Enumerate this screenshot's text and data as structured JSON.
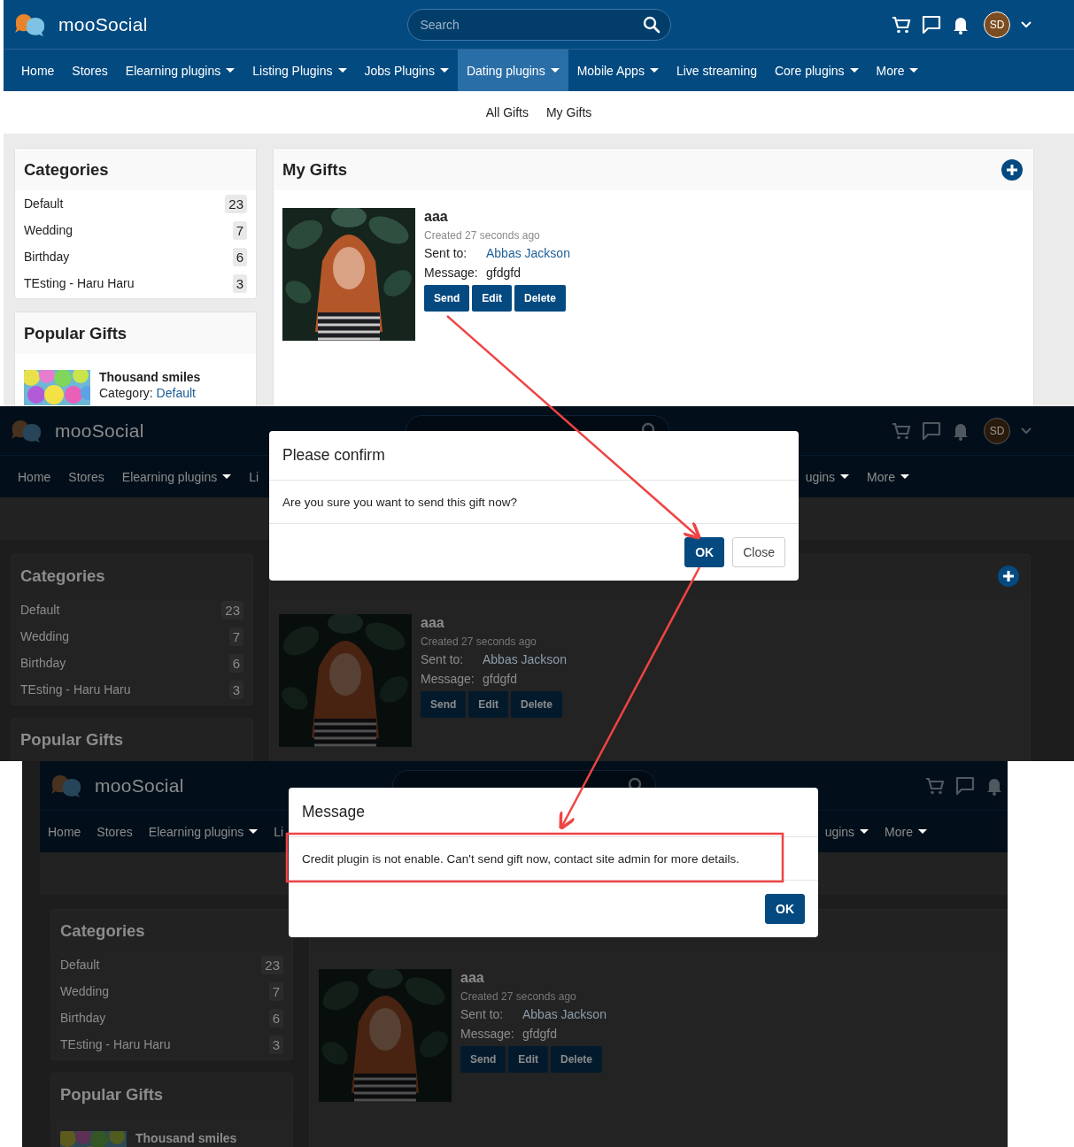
{
  "screens": [
    {
      "dimmed": false,
      "header": {
        "logo": "mooSocial",
        "search_placeholder": "Search",
        "avatar": "SD"
      },
      "nav_left": [
        {
          "label": "Home",
          "dropdown": false,
          "selected": false
        },
        {
          "label": "Stores",
          "dropdown": false,
          "selected": false
        },
        {
          "label": "Elearning plugins",
          "dropdown": true,
          "selected": false
        },
        {
          "label": "Listing Plugins",
          "dropdown": true,
          "selected": false
        },
        {
          "label": "Jobs Plugins",
          "dropdown": true,
          "selected": false
        },
        {
          "label": "Dating plugins",
          "dropdown": true,
          "selected": true
        },
        {
          "label": "Mobile Apps",
          "dropdown": true,
          "selected": false
        },
        {
          "label": "Live streaming",
          "dropdown": false,
          "selected": false
        },
        {
          "label": "Core plugins",
          "dropdown": true,
          "selected": false
        },
        {
          "label": "More",
          "dropdown": true,
          "selected": false
        }
      ],
      "subnav": [
        "All Gifts",
        "My Gifts"
      ],
      "categories": {
        "title": "Categories",
        "items": [
          {
            "name": "Default",
            "count": "23"
          },
          {
            "name": "Wedding",
            "count": "7"
          },
          {
            "name": "Birthday",
            "count": "6"
          },
          {
            "name": "TEsting - Haru Haru",
            "count": "3"
          }
        ]
      },
      "popular": {
        "title": "Popular Gifts",
        "items": [
          {
            "name": "Thousand smiles",
            "category_label": "Category:",
            "category": "Default"
          }
        ]
      },
      "gifts": {
        "title": "My Gifts",
        "show_add": true,
        "items": [
          {
            "name": "aaa",
            "created": "Created 27 seconds ago",
            "sent_label": "Sent to:",
            "recipient": "Abbas Jackson",
            "message_label": "Message:",
            "message": "gfdgfd",
            "actions": [
              "Send",
              "Edit",
              "Delete"
            ]
          }
        ]
      }
    },
    {
      "dimmed": true,
      "header": {
        "logo": "mooSocial",
        "avatar": "SD"
      },
      "nav_left": [
        {
          "label": "Home",
          "dropdown": false,
          "selected": false
        },
        {
          "label": "Stores",
          "dropdown": false,
          "selected": false
        },
        {
          "label": "Elearning plugins",
          "dropdown": true,
          "selected": false
        },
        {
          "label": "Li",
          "dropdown": false,
          "selected": false
        }
      ],
      "nav_right": [
        {
          "label": "ugins",
          "dropdown": true,
          "selected": false
        },
        {
          "label": "More",
          "dropdown": true,
          "selected": false
        }
      ],
      "categories": {
        "title": "Categories",
        "items": [
          {
            "name": "Default",
            "count": "23"
          },
          {
            "name": "Wedding",
            "count": "7"
          },
          {
            "name": "Birthday",
            "count": "6"
          },
          {
            "name": "TEsting - Haru Haru",
            "count": "3"
          }
        ]
      },
      "popular": {
        "title": "Popular Gifts"
      },
      "gifts": {
        "show_add": true,
        "items": [
          {
            "name": "aaa",
            "created": "Created 27 seconds ago",
            "sent_label": "Sent to:",
            "recipient": "Abbas Jackson",
            "message_label": "Message:",
            "message": "gfdgfd",
            "actions": [
              "Send",
              "Edit",
              "Delete"
            ]
          }
        ]
      },
      "modal": {
        "title": "Please confirm",
        "body": "Are you sure you want to send this gift now?",
        "buttons": [
          {
            "label": "OK",
            "kind": "primary"
          },
          {
            "label": "Close",
            "kind": "default"
          }
        ]
      }
    },
    {
      "dimmed": true,
      "header": {
        "logo": "mooSocial"
      },
      "nav_left": [
        {
          "label": "Home",
          "dropdown": false,
          "selected": false
        },
        {
          "label": "Stores",
          "dropdown": false,
          "selected": false
        },
        {
          "label": "Elearning plugins",
          "dropdown": true,
          "selected": false
        },
        {
          "label": "Li",
          "dropdown": false,
          "selected": false
        }
      ],
      "nav_right": [
        {
          "label": "ugins",
          "dropdown": true,
          "selected": false
        },
        {
          "label": "More",
          "dropdown": true,
          "selected": false
        }
      ],
      "categories": {
        "title": "Categories",
        "items": [
          {
            "name": "Default",
            "count": "23"
          },
          {
            "name": "Wedding",
            "count": "7"
          },
          {
            "name": "Birthday",
            "count": "6"
          },
          {
            "name": "TEsting - Haru Haru",
            "count": "3"
          }
        ]
      },
      "popular": {
        "title": "Popular Gifts",
        "items": [
          {
            "name": "Thousand smiles"
          }
        ]
      },
      "gifts": {
        "show_add": false,
        "items": [
          {
            "name": "aaa",
            "created": "Created 27 seconds ago",
            "sent_label": "Sent to:",
            "recipient": "Abbas Jackson",
            "message_label": "Message:",
            "message": "gfdgfd",
            "actions": [
              "Send",
              "Edit",
              "Delete"
            ]
          }
        ]
      },
      "modal": {
        "title": "Message",
        "body": "Credit plugin is not enable. Can't send gift now, contact site admin for more details.",
        "buttons": [
          {
            "label": "OK",
            "kind": "primary"
          }
        ]
      }
    }
  ]
}
